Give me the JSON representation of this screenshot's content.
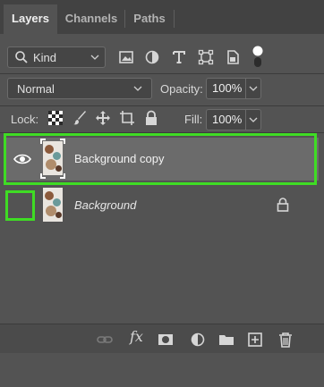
{
  "tabs": [
    {
      "label": "Layers",
      "active": true
    },
    {
      "label": "Channels",
      "active": false
    },
    {
      "label": "Paths",
      "active": false
    }
  ],
  "filter": {
    "kind_label": "Kind",
    "icons": [
      "image-filter-icon",
      "adjustment-filter-icon",
      "type-filter-icon",
      "shape-filter-icon",
      "smart-object-filter-icon"
    ]
  },
  "blend": {
    "mode": "Normal",
    "opacity_label": "Opacity:",
    "opacity_value": "100%",
    "fill_label": "Fill:",
    "fill_value": "100%",
    "lock_label": "Lock:"
  },
  "layers": [
    {
      "name": "Background copy",
      "visible": true,
      "selected": true,
      "locked": false,
      "italic": false
    },
    {
      "name": "Background",
      "visible": false,
      "selected": false,
      "locked": true,
      "italic": true
    }
  ],
  "bottom_bar": {
    "fx_label": "fx",
    "icons": [
      "link-layers-icon",
      "fx-icon",
      "add-mask-icon",
      "adjustment-layer-icon",
      "new-group-icon",
      "new-layer-icon",
      "delete-layer-icon"
    ]
  },
  "colors": {
    "panel_bg": "#535353",
    "selected_row": "#6b6b6b",
    "highlight": "#3fdc24"
  }
}
